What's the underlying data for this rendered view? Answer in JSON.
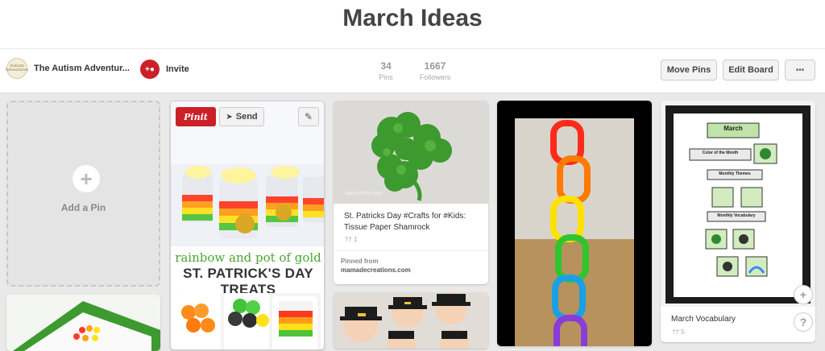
{
  "board": {
    "title": "March Ideas",
    "owner": "The Autism Adventur...",
    "owner_avatar_text": "Autism Adventures",
    "invite_label": "Invite",
    "stats": [
      {
        "value": "34",
        "label": "Pins"
      },
      {
        "value": "1667",
        "label": "Followers"
      }
    ],
    "buttons": {
      "move_pins": "Move Pins",
      "edit_board": "Edit Board",
      "more": "•••"
    }
  },
  "add_pin": {
    "label": "Add a Pin",
    "icon": "plus-icon"
  },
  "pins": [
    {
      "image_text_top": "rainbow and pot of gold",
      "image_text_bottom": "ST. PATRICK'S DAY TREATS",
      "pinit_label": "Pinit",
      "send_label": "Send",
      "send_icon": "paper-plane-icon",
      "edit_icon": "pencil-icon"
    },
    {
      "watermark": "sancyfrocr.com",
      "description": "St. Patricks Day #Crafts for #Kids: Tissue Paper Shamrock",
      "repins": "1",
      "pinned_from_label": "Pinned from",
      "source": "mamadecreations.com"
    },
    {
      "image": "rainbow paper chain"
    },
    {
      "chart_title": "March",
      "label_color": "Color of the Month",
      "label_themes": "Monthly Themes",
      "label_vocab": "Monthly Vocabulary",
      "description": "March Vocabulary",
      "repins": "5"
    }
  ],
  "floating": {
    "add_icon": "plus",
    "help_icon": "?"
  },
  "colors": {
    "brand_red": "#cb2027",
    "shamrock_green": "#3c9a2e",
    "chain": [
      "#ff2a1a",
      "#ff7a00",
      "#ffe100",
      "#2fc52f",
      "#1aa0e8",
      "#8a3cd8"
    ]
  }
}
